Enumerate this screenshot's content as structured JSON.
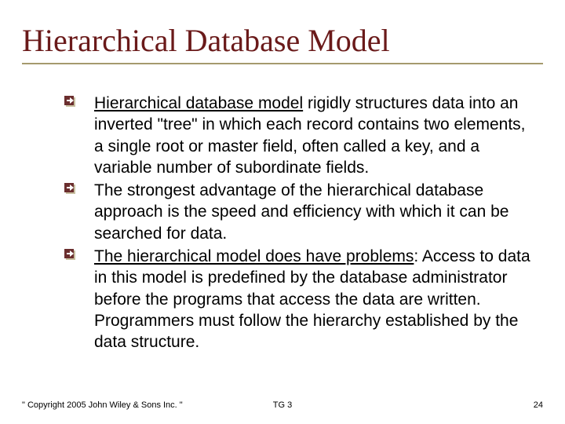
{
  "title": "Hierarchical Database Model",
  "bullets": [
    {
      "lead": "Hierarchical database model",
      "rest": " rigidly structures data into an inverted \"tree\" in which each record contains two elements, a single root or master field, often called a key, and a variable number of subordinate fields."
    },
    {
      "lead": "",
      "rest": "The strongest advantage of the hierarchical database approach is the speed and efficiency with which it can be searched for data."
    },
    {
      "lead": "The hierarchical model does have problems",
      "rest": ": Access to data in this model is predefined by the database administrator before the programs that access the data are written. Programmers must follow the hierarchy established by the data structure."
    }
  ],
  "footer": {
    "left": "\" Copyright 2005 John Wiley & Sons Inc. \"",
    "center": "TG 3",
    "right": "24"
  },
  "colors": {
    "title": "#6a1a1a",
    "rule": "#a59a6e",
    "bullet_fill": "#6b2e2e",
    "bullet_shadow": "#c7bfa0"
  }
}
